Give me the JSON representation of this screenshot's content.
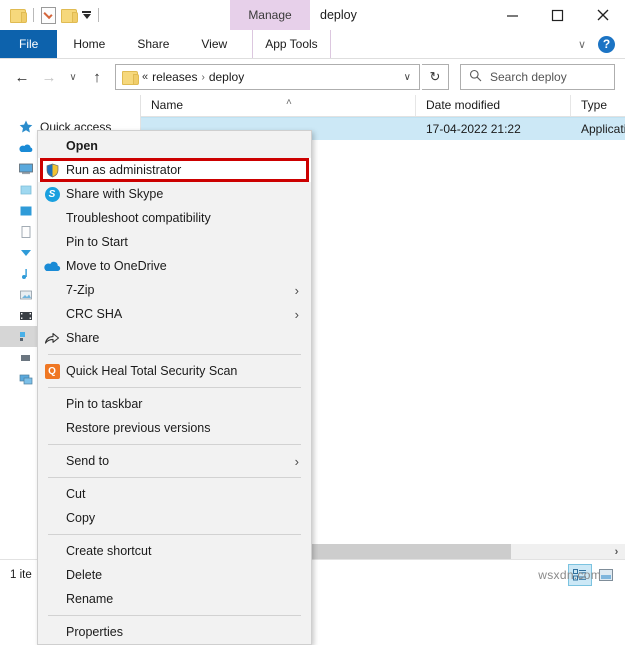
{
  "window": {
    "title": "deploy",
    "quick_access_toolbar": [
      {
        "name": "folder-icon",
        "label": ""
      },
      {
        "name": "properties-icon",
        "label": ""
      },
      {
        "name": "new-folder-icon",
        "label": ""
      },
      {
        "name": "customize-dropdown-icon",
        "label": ""
      }
    ],
    "contextual_tab": "Manage",
    "controls": {
      "minimize": "—",
      "maximize": "□",
      "close": "✕",
      "ribbon_collapse": "∨",
      "help": "?"
    }
  },
  "ribbon": {
    "tabs": [
      {
        "label": "File",
        "active": true
      },
      {
        "label": "Home",
        "active": false
      },
      {
        "label": "Share",
        "active": false
      },
      {
        "label": "View",
        "active": false
      },
      {
        "label": "App Tools",
        "active": false
      }
    ]
  },
  "navigation": {
    "back": "←",
    "forward": "→",
    "recent": "∨",
    "up": "↑",
    "breadcrumb": {
      "overflow": "«",
      "parts": [
        "releases",
        "deploy"
      ],
      "separator": "›",
      "dropdown": "∨"
    },
    "refresh": "↻",
    "search": {
      "icon": "search-icon",
      "placeholder": "Search deploy",
      "value": ""
    }
  },
  "sidebar": {
    "items": [
      {
        "label": "Quick access",
        "icon": "star-icon",
        "selected": false
      },
      {
        "label": "",
        "icon": "onedrive-icon",
        "selected": false
      },
      {
        "label": "",
        "icon": "this-pc-icon",
        "selected": false
      },
      {
        "label": "",
        "icon": "drive-icon",
        "selected": false
      },
      {
        "label": "",
        "icon": "folder-icon",
        "selected": false
      },
      {
        "label": "",
        "icon": "documents-icon",
        "selected": false
      },
      {
        "label": "",
        "icon": "downloads-icon",
        "selected": false
      },
      {
        "label": "",
        "icon": "music-icon",
        "selected": false
      },
      {
        "label": "",
        "icon": "pictures-icon",
        "selected": false
      },
      {
        "label": "",
        "icon": "videos-icon",
        "selected": false
      },
      {
        "label": "",
        "icon": "local-disk-icon",
        "selected": true
      },
      {
        "label": "",
        "icon": "disk-icon",
        "selected": false
      },
      {
        "label": "",
        "icon": "network-icon",
        "selected": false
      }
    ]
  },
  "file_list": {
    "columns": [
      "Name",
      "Date modified",
      "Type"
    ],
    "sort_indicator": "˄",
    "rows": [
      {
        "name": "",
        "date_modified": "17-04-2022 21:22",
        "type": "Application",
        "selected": true
      }
    ]
  },
  "context_menu": {
    "highlighted_item": "Run as administrator",
    "items": [
      {
        "label": "Open",
        "icon": null,
        "bold": true,
        "submenu": false,
        "separator_after": false
      },
      {
        "label": "Run as administrator",
        "icon": "uac-shield-icon",
        "bold": false,
        "submenu": false,
        "separator_after": false,
        "highlighted": true
      },
      {
        "label": "Share with Skype",
        "icon": "skype-icon",
        "bold": false,
        "submenu": false,
        "separator_after": false
      },
      {
        "label": "Troubleshoot compatibility",
        "icon": null,
        "bold": false,
        "submenu": false,
        "separator_after": false
      },
      {
        "label": "Pin to Start",
        "icon": null,
        "bold": false,
        "submenu": false,
        "separator_after": false
      },
      {
        "label": "Move to OneDrive",
        "icon": "onedrive-icon",
        "bold": false,
        "submenu": false,
        "separator_after": false
      },
      {
        "label": "7-Zip",
        "icon": null,
        "bold": false,
        "submenu": true,
        "separator_after": false
      },
      {
        "label": "CRC SHA",
        "icon": null,
        "bold": false,
        "submenu": true,
        "separator_after": false
      },
      {
        "label": "Share",
        "icon": "share-icon",
        "bold": false,
        "submenu": false,
        "separator_after": true
      },
      {
        "label": "Quick Heal Total Security Scan",
        "icon": "quick-heal-icon",
        "bold": false,
        "submenu": false,
        "separator_after": true
      },
      {
        "label": "Pin to taskbar",
        "icon": null,
        "bold": false,
        "submenu": false,
        "separator_after": false
      },
      {
        "label": "Restore previous versions",
        "icon": null,
        "bold": false,
        "submenu": false,
        "separator_after": true
      },
      {
        "label": "Send to",
        "icon": null,
        "bold": false,
        "submenu": true,
        "separator_after": true
      },
      {
        "label": "Cut",
        "icon": null,
        "bold": false,
        "submenu": false,
        "separator_after": false
      },
      {
        "label": "Copy",
        "icon": null,
        "bold": false,
        "submenu": false,
        "separator_after": true
      },
      {
        "label": "Create shortcut",
        "icon": null,
        "bold": false,
        "submenu": false,
        "separator_after": false
      },
      {
        "label": "Delete",
        "icon": null,
        "bold": false,
        "submenu": false,
        "separator_after": false
      },
      {
        "label": "Rename",
        "icon": null,
        "bold": false,
        "submenu": false,
        "separator_after": true
      },
      {
        "label": "Properties",
        "icon": null,
        "bold": false,
        "submenu": false,
        "separator_after": false
      }
    ],
    "submenu_arrow": "›"
  },
  "status_bar": {
    "item_count": "1 ite",
    "views": [
      {
        "name": "details-view-button",
        "active": true
      },
      {
        "name": "large-icons-view-button",
        "active": false
      }
    ]
  },
  "watermark": "wsxdn.com",
  "colors": {
    "file_tab": "#0d62ac",
    "manage_tab": "#e7d0ea",
    "selection": "#cce8f6",
    "highlight_box": "#cc0000",
    "menu_bg": "#f2f2f2"
  }
}
